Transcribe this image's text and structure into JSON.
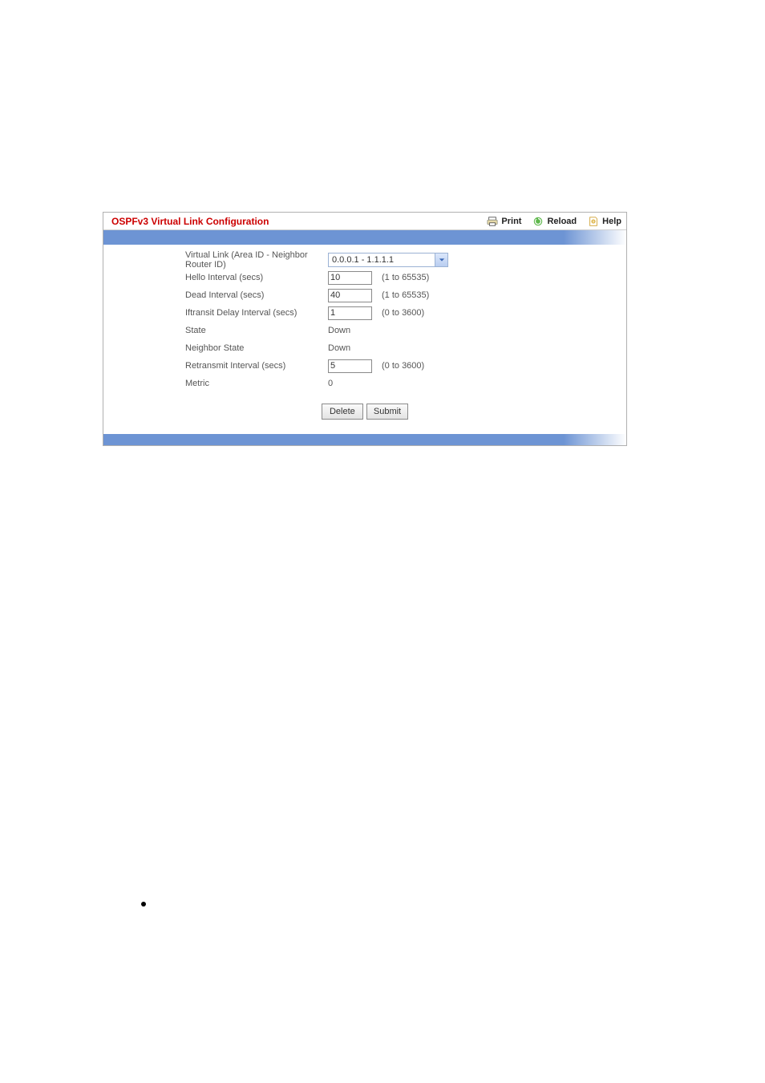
{
  "header": {
    "title": "OSPFv3 Virtual Link Configuration",
    "print": "Print",
    "reload": "Reload",
    "help": "Help"
  },
  "form": {
    "virtual_link": {
      "label": "Virtual Link (Area ID - Neighbor Router ID)",
      "selected": "0.0.0.1 - 1.1.1.1"
    },
    "hello_interval": {
      "label": "Hello Interval (secs)",
      "value": "10",
      "hint": "(1 to 65535)"
    },
    "dead_interval": {
      "label": "Dead Interval (secs)",
      "value": "40",
      "hint": "(1 to 65535)"
    },
    "iftransit_delay": {
      "label": "Iftransit Delay Interval (secs)",
      "value": "1",
      "hint": "(0 to 3600)"
    },
    "state": {
      "label": "State",
      "value": "Down"
    },
    "neighbor_state": {
      "label": "Neighbor State",
      "value": "Down"
    },
    "retransmit_interval": {
      "label": "Retransmit Interval (secs)",
      "value": "5",
      "hint": "(0 to 3600)"
    },
    "metric": {
      "label": "Metric",
      "value": "0"
    }
  },
  "buttons": {
    "delete": "Delete",
    "submit": "Submit"
  }
}
